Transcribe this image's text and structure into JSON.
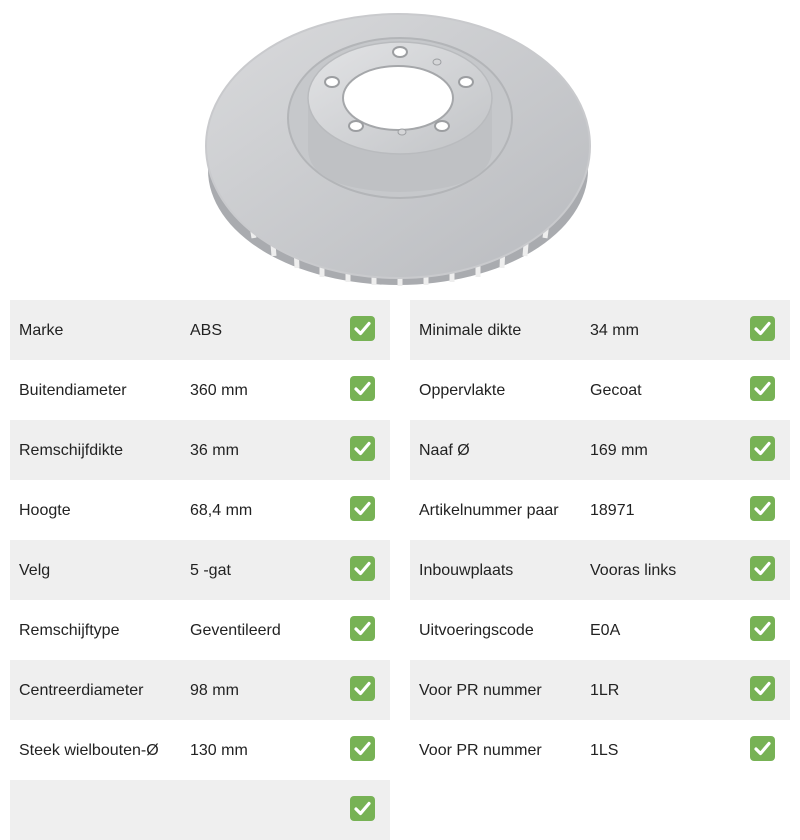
{
  "product_image": {
    "icon": "brake-disc-image"
  },
  "colors": {
    "row_shade": "#efefef",
    "check_green": "#77b255",
    "text": "#222222"
  },
  "specs": {
    "left": [
      {
        "label": "Marke",
        "value": "ABS",
        "checked": true
      },
      {
        "label": "Buitendiameter",
        "value": "360 mm",
        "checked": true
      },
      {
        "label": "Remschijfdikte",
        "value": "36 mm",
        "checked": true
      },
      {
        "label": "Hoogte",
        "value": "68,4 mm",
        "checked": true
      },
      {
        "label": "Velg",
        "value": "5 -gat",
        "checked": true
      },
      {
        "label": "Remschijftype",
        "value": "Geventileerd",
        "checked": true
      },
      {
        "label": "Centreerdiameter",
        "value": "98 mm",
        "checked": true
      },
      {
        "label": "Steek wielbouten-Ø",
        "value": "130 mm",
        "checked": true
      },
      {
        "label": "",
        "value": "",
        "checked": true
      }
    ],
    "right": [
      {
        "label": "Minimale dikte",
        "value": "34 mm",
        "checked": true
      },
      {
        "label": "Oppervlakte",
        "value": "Gecoat",
        "checked": true
      },
      {
        "label": "Naaf Ø",
        "value": "169 mm",
        "checked": true
      },
      {
        "label": "Artikelnummer paar",
        "value": "18971",
        "checked": true
      },
      {
        "label": "Inbouwplaats",
        "value": "Vooras links",
        "checked": true
      },
      {
        "label": "Uitvoeringscode",
        "value": "E0A",
        "checked": true
      },
      {
        "label": "Voor PR nummer",
        "value": "1LR",
        "checked": true
      },
      {
        "label": "Voor PR nummer",
        "value": "1LS",
        "checked": true
      }
    ]
  }
}
